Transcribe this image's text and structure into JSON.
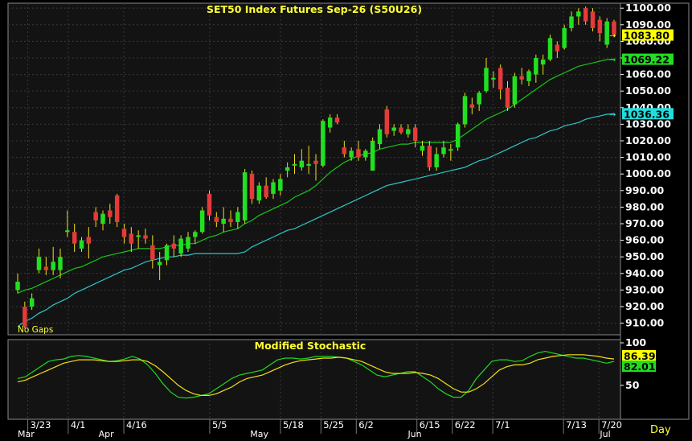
{
  "title": "SET50  Index  Futures  Sep-26  (S50U26)",
  "gaps_label": "No  Gaps",
  "stoch_title": "Modified  Stochastic",
  "period_label": "Day",
  "colors": {
    "background": "#000000",
    "panel": "#131313",
    "grid": "#3a3a3a",
    "up": "#21e021",
    "down": "#e43a3a",
    "ma_short": "#17c417",
    "ma_long": "#2ec6c6",
    "stoch_fast": "#20d820",
    "stoch_slow": "#f0e020",
    "title": "#ffff33",
    "axis_text": "#ffffff"
  },
  "chart_data": [
    {
      "type": "candlestick",
      "title": "SET50  Index  Futures  Sep-26  (S50U26)",
      "ylim": [
        903,
        1103
      ],
      "y_ticks": [
        "1100.00",
        "1090.00",
        "1080.00",
        "1070.00",
        "1060.00",
        "1050.00",
        "1040.00",
        "1030.00",
        "1020.00",
        "1010.00",
        "1000.00",
        "990.00",
        "980.00",
        "970.00",
        "960.00",
        "950.00",
        "940.00",
        "930.00",
        "920.00",
        "910.00"
      ],
      "x_ticks": [
        "3/23",
        "4/1",
        "4/16",
        "5/5",
        "5/18",
        "5/25",
        "6/2",
        "6/15",
        "6/22",
        "7/1",
        "7/13",
        "7/20"
      ],
      "month_labels": [
        "Mar",
        "Apr",
        "May",
        "Jun",
        "Jul"
      ],
      "value_labels": [
        {
          "text": "1083.80",
          "value": 1083.8,
          "bg": "#ffff00",
          "fg": "#000000"
        },
        {
          "text": "1069.22",
          "value": 1069.22,
          "bg": "#22dd22",
          "fg": "#000000"
        },
        {
          "text": "1036.36",
          "value": 1036.36,
          "bg": "#22dddd",
          "fg": "#000000"
        }
      ],
      "candles": [
        {
          "o": 930,
          "h": 940,
          "l": 928,
          "c": 935
        },
        {
          "o": 920,
          "h": 923,
          "l": 907,
          "c": 908
        },
        {
          "o": 920,
          "h": 928,
          "l": 918,
          "c": 925
        },
        {
          "o": 942,
          "h": 955,
          "l": 940,
          "c": 950
        },
        {
          "o": 944,
          "h": 950,
          "l": 939,
          "c": 942
        },
        {
          "o": 942,
          "h": 956,
          "l": 939,
          "c": 947
        },
        {
          "o": 942,
          "h": 955,
          "l": 937,
          "c": 950
        },
        {
          "o": 965,
          "h": 978,
          "l": 962,
          "c": 966
        },
        {
          "o": 965,
          "h": 970,
          "l": 953,
          "c": 958
        },
        {
          "o": 955,
          "h": 962,
          "l": 953,
          "c": 960
        },
        {
          "o": 962,
          "h": 968,
          "l": 949,
          "c": 958
        },
        {
          "o": 977,
          "h": 980,
          "l": 968,
          "c": 972
        },
        {
          "o": 970,
          "h": 978,
          "l": 966,
          "c": 976
        },
        {
          "o": 978,
          "h": 982,
          "l": 970,
          "c": 974
        },
        {
          "o": 987,
          "h": 988,
          "l": 968,
          "c": 971
        },
        {
          "o": 967,
          "h": 970,
          "l": 958,
          "c": 962
        },
        {
          "o": 964,
          "h": 968,
          "l": 953,
          "c": 958
        },
        {
          "o": 962,
          "h": 966,
          "l": 955,
          "c": 963
        },
        {
          "o": 963,
          "h": 967,
          "l": 958,
          "c": 961
        },
        {
          "o": 957,
          "h": 963,
          "l": 943,
          "c": 948
        },
        {
          "o": 945,
          "h": 953,
          "l": 936,
          "c": 947
        },
        {
          "o": 948,
          "h": 958,
          "l": 945,
          "c": 957
        },
        {
          "o": 958,
          "h": 963,
          "l": 950,
          "c": 955
        },
        {
          "o": 952,
          "h": 963,
          "l": 950,
          "c": 961
        },
        {
          "o": 955,
          "h": 965,
          "l": 953,
          "c": 962
        },
        {
          "o": 962,
          "h": 966,
          "l": 958,
          "c": 965
        },
        {
          "o": 965,
          "h": 980,
          "l": 964,
          "c": 978
        },
        {
          "o": 988,
          "h": 990,
          "l": 972,
          "c": 975
        },
        {
          "o": 974,
          "h": 977,
          "l": 968,
          "c": 971
        },
        {
          "o": 970,
          "h": 980,
          "l": 965,
          "c": 973
        },
        {
          "o": 973,
          "h": 978,
          "l": 968,
          "c": 971
        },
        {
          "o": 971,
          "h": 980,
          "l": 967,
          "c": 977
        },
        {
          "o": 972,
          "h": 1003,
          "l": 970,
          "c": 1001
        },
        {
          "o": 1000,
          "h": 1002,
          "l": 982,
          "c": 985
        },
        {
          "o": 984,
          "h": 995,
          "l": 982,
          "c": 993
        },
        {
          "o": 993,
          "h": 998,
          "l": 985,
          "c": 986
        },
        {
          "o": 988,
          "h": 997,
          "l": 985,
          "c": 995
        },
        {
          "o": 990,
          "h": 1000,
          "l": 987,
          "c": 997
        },
        {
          "o": 1002,
          "h": 1007,
          "l": 998,
          "c": 1004
        },
        {
          "o": 1005,
          "h": 1012,
          "l": 1000,
          "c": 1006
        },
        {
          "o": 1004,
          "h": 1015,
          "l": 1002,
          "c": 1008
        },
        {
          "o": 1005,
          "h": 1017,
          "l": 1000,
          "c": 1006
        },
        {
          "o": 1008,
          "h": 1012,
          "l": 996,
          "c": 1006
        },
        {
          "o": 1005,
          "h": 1033,
          "l": 1004,
          "c": 1032
        },
        {
          "o": 1028,
          "h": 1036,
          "l": 1025,
          "c": 1034
        },
        {
          "o": 1034,
          "h": 1036,
          "l": 1030,
          "c": 1031
        },
        {
          "o": 1016,
          "h": 1020,
          "l": 1010,
          "c": 1012
        },
        {
          "o": 1010,
          "h": 1016,
          "l": 1008,
          "c": 1014
        },
        {
          "o": 1015,
          "h": 1020,
          "l": 1008,
          "c": 1010
        },
        {
          "o": 1010,
          "h": 1015,
          "l": 1008,
          "c": 1014
        },
        {
          "o": 1002,
          "h": 1022,
          "l": 1002,
          "c": 1020
        },
        {
          "o": 1018,
          "h": 1030,
          "l": 1015,
          "c": 1027
        },
        {
          "o": 1039,
          "h": 1041,
          "l": 1022,
          "c": 1024
        },
        {
          "o": 1026,
          "h": 1030,
          "l": 1023,
          "c": 1028
        },
        {
          "o": 1028,
          "h": 1030,
          "l": 1024,
          "c": 1025
        },
        {
          "o": 1024,
          "h": 1030,
          "l": 1022,
          "c": 1027
        },
        {
          "o": 1028,
          "h": 1030,
          "l": 1016,
          "c": 1020
        },
        {
          "o": 1014,
          "h": 1020,
          "l": 1011,
          "c": 1017
        },
        {
          "o": 1017,
          "h": 1020,
          "l": 1002,
          "c": 1004
        },
        {
          "o": 1004,
          "h": 1016,
          "l": 1002,
          "c": 1012
        },
        {
          "o": 1012,
          "h": 1020,
          "l": 1010,
          "c": 1016
        },
        {
          "o": 1014,
          "h": 1018,
          "l": 1008,
          "c": 1015
        },
        {
          "o": 1016,
          "h": 1031,
          "l": 1014,
          "c": 1030
        },
        {
          "o": 1030,
          "h": 1049,
          "l": 1028,
          "c": 1047
        },
        {
          "o": 1042,
          "h": 1046,
          "l": 1036,
          "c": 1040
        },
        {
          "o": 1042,
          "h": 1050,
          "l": 1038,
          "c": 1049
        },
        {
          "o": 1050,
          "h": 1070,
          "l": 1049,
          "c": 1064
        },
        {
          "o": 1057,
          "h": 1062,
          "l": 1052,
          "c": 1058
        },
        {
          "o": 1064,
          "h": 1066,
          "l": 1045,
          "c": 1051
        },
        {
          "o": 1052,
          "h": 1056,
          "l": 1038,
          "c": 1040
        },
        {
          "o": 1042,
          "h": 1061,
          "l": 1040,
          "c": 1059
        },
        {
          "o": 1059,
          "h": 1064,
          "l": 1054,
          "c": 1057
        },
        {
          "o": 1056,
          "h": 1063,
          "l": 1053,
          "c": 1062
        },
        {
          "o": 1060,
          "h": 1072,
          "l": 1055,
          "c": 1070
        },
        {
          "o": 1066,
          "h": 1072,
          "l": 1060,
          "c": 1069
        },
        {
          "o": 1069,
          "h": 1084,
          "l": 1068,
          "c": 1082
        },
        {
          "o": 1078,
          "h": 1080,
          "l": 1070,
          "c": 1074
        },
        {
          "o": 1076,
          "h": 1090,
          "l": 1075,
          "c": 1088
        },
        {
          "o": 1088,
          "h": 1098,
          "l": 1086,
          "c": 1095
        },
        {
          "o": 1095,
          "h": 1100,
          "l": 1090,
          "c": 1098
        },
        {
          "o": 1100,
          "h": 1101,
          "l": 1090,
          "c": 1092
        },
        {
          "o": 1098,
          "h": 1100,
          "l": 1086,
          "c": 1088
        },
        {
          "o": 1093,
          "h": 1095,
          "l": 1080,
          "c": 1085
        },
        {
          "o": 1078,
          "h": 1094,
          "l": 1076,
          "c": 1092
        },
        {
          "o": 1092,
          "h": 1093,
          "l": 1083,
          "c": 1084
        }
      ],
      "ma_short": [
        928,
        930,
        931,
        933,
        935,
        937,
        939,
        941,
        943,
        944,
        946,
        948,
        950,
        951,
        952,
        953,
        954,
        955,
        955,
        955,
        955,
        956,
        957,
        957,
        958,
        958,
        960,
        962,
        963,
        965,
        966,
        967,
        970,
        972,
        975,
        977,
        979,
        981,
        983,
        986,
        988,
        990,
        993,
        997,
        1001,
        1004,
        1007,
        1009,
        1011,
        1012,
        1013,
        1015,
        1016,
        1017,
        1018,
        1018,
        1019,
        1019,
        1019,
        1019,
        1019,
        1019,
        1021,
        1024,
        1027,
        1030,
        1033,
        1035,
        1037,
        1039,
        1042,
        1045,
        1048,
        1051,
        1054,
        1057,
        1059,
        1061,
        1063,
        1065,
        1066,
        1067,
        1068,
        1069,
        1069.22
      ],
      "ma_long": [
        908,
        911,
        913,
        916,
        918,
        921,
        923,
        925,
        928,
        930,
        932,
        934,
        936,
        938,
        940,
        942,
        943,
        945,
        947,
        948,
        949,
        950,
        950,
        951,
        951,
        952,
        952,
        952,
        952,
        952,
        952,
        952,
        953,
        956,
        958,
        960,
        962,
        964,
        966,
        967,
        969,
        971,
        973,
        975,
        977,
        979,
        981,
        983,
        985,
        987,
        989,
        991,
        993,
        994,
        995,
        996,
        997,
        998,
        999,
        1000,
        1001,
        1002,
        1003,
        1004,
        1006,
        1008,
        1009,
        1011,
        1013,
        1015,
        1017,
        1019,
        1021,
        1022,
        1024,
        1026,
        1027,
        1029,
        1030,
        1031,
        1033,
        1034,
        1035,
        1036,
        1036.36
      ]
    },
    {
      "type": "line",
      "title": "Modified  Stochastic",
      "ylim": [
        10,
        100
      ],
      "y_ticks": [
        "100",
        "50"
      ],
      "value_labels": [
        {
          "text": "86.39",
          "value": 86.39,
          "bg": "#ffff00",
          "fg": "#000000"
        },
        {
          "text": "82.01",
          "value": 82.01,
          "bg": "#22dd22",
          "fg": "#000000"
        }
      ],
      "series": [
        {
          "values": [
            58,
            60,
            66,
            72,
            78,
            80,
            81,
            84,
            85,
            84,
            82,
            80,
            78,
            79,
            81,
            84,
            81,
            74,
            64,
            52,
            42,
            36,
            35,
            36,
            38,
            40,
            46,
            52,
            58,
            62,
            64,
            66,
            68,
            74,
            80,
            82,
            82,
            81,
            82,
            84,
            84,
            84,
            83,
            82,
            78,
            74,
            68,
            62,
            60,
            62,
            64,
            66,
            66,
            60,
            54,
            46,
            40,
            36,
            36,
            44,
            58,
            68,
            78,
            80,
            80,
            78,
            79,
            84,
            88,
            90,
            88,
            86,
            84,
            82,
            82,
            80,
            78,
            76,
            78
          ]
        },
        {
          "values": [
            54,
            56,
            60,
            64,
            68,
            72,
            76,
            78,
            80,
            80,
            80,
            79,
            78,
            78,
            79,
            80,
            80,
            78,
            73,
            66,
            58,
            50,
            44,
            40,
            38,
            38,
            40,
            44,
            48,
            54,
            58,
            60,
            62,
            66,
            70,
            74,
            77,
            79,
            80,
            81,
            82,
            82,
            83,
            82,
            80,
            78,
            74,
            70,
            66,
            64,
            64,
            64,
            65,
            64,
            62,
            58,
            52,
            46,
            42,
            42,
            46,
            52,
            60,
            68,
            72,
            74,
            74,
            76,
            80,
            82,
            84,
            85,
            86,
            86,
            86,
            85,
            84,
            82,
            81
          ]
        }
      ]
    }
  ]
}
